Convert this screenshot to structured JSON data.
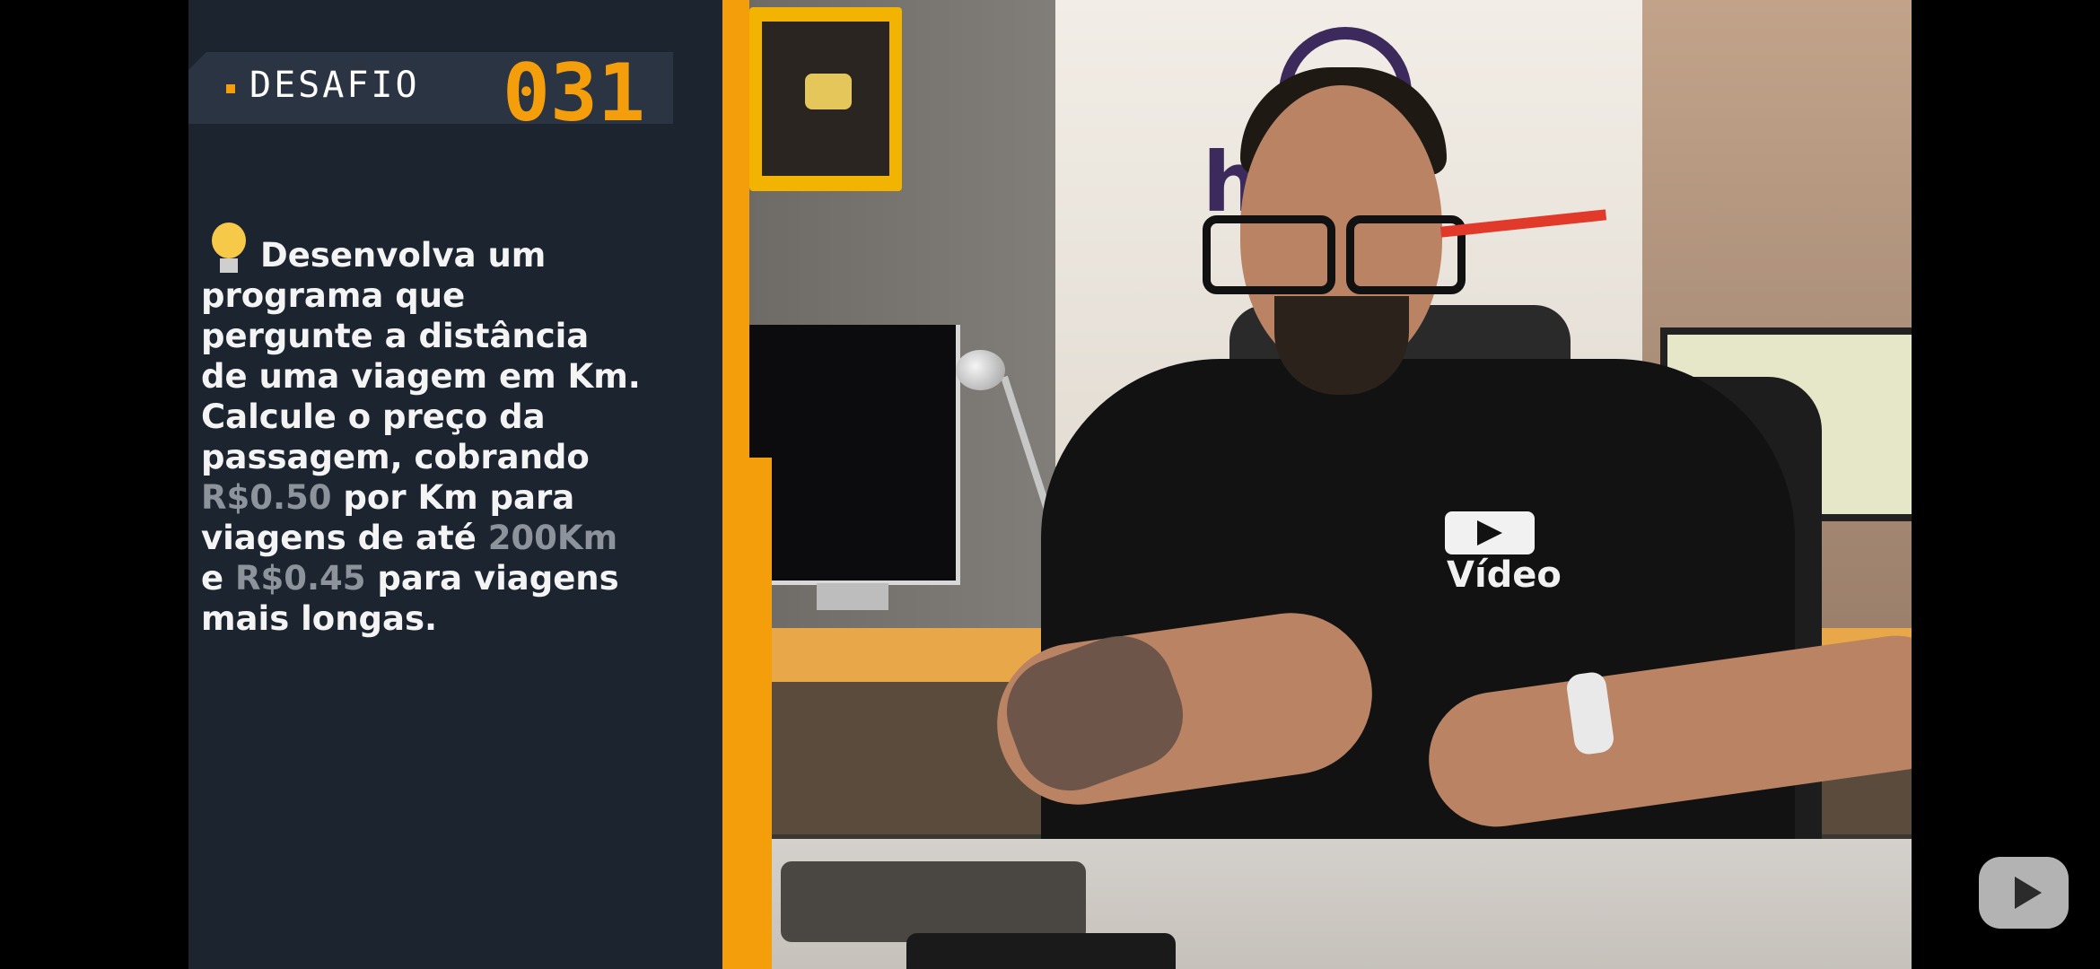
{
  "overlay": {
    "label": "DESAFIO",
    "number": "031",
    "accent_color": "#f59e0b",
    "lines": [
      {
        "text": "Desenvolva um"
      },
      {
        "text": "programa que"
      },
      {
        "text": "pergunte a distância"
      },
      {
        "text": "de uma viagem em Km."
      },
      {
        "text": "Calcule o preço da"
      },
      {
        "text": "passagem, cobrando"
      },
      {
        "parts": [
          "R$0.50",
          " por Km para"
        ]
      },
      {
        "parts": [
          "viagens de até ",
          "200Km"
        ]
      },
      {
        "parts": [
          "e ",
          "R$0.45",
          " para viagens"
        ]
      },
      {
        "text": "mais longas."
      }
    ]
  },
  "scene": {
    "wall_logo": "host",
    "shirt_logo": "Vídeo"
  },
  "youtube_button_icon": "play-icon"
}
